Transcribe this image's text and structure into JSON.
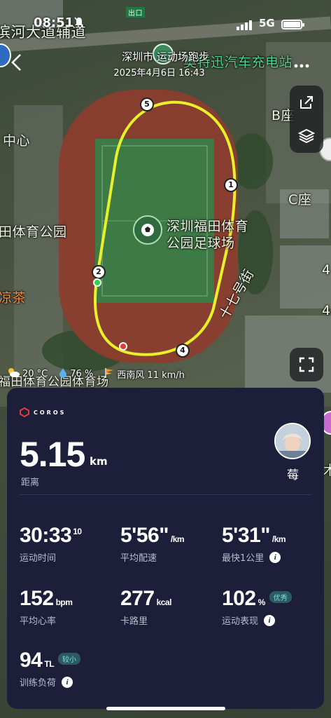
{
  "status_bar": {
    "time": "08:51",
    "network": "5G"
  },
  "header": {
    "title": "深圳市 运动场跑步",
    "subtitle": "2025年4月6日 16:43"
  },
  "map": {
    "labels": {
      "road_top": "滨河大道辅道",
      "poi_top_right": "奥特迅汽车充电站",
      "building_b": "B座",
      "building_c": "C座",
      "center_left": "中心",
      "park_left": "田体育公园",
      "tea": "凉茶",
      "stadium": "深圳福田体育",
      "stadium_line2": "公园足球场",
      "street": "十七号街",
      "park_bottom": "福田体育公园体育场",
      "edge_4a": "4",
      "edge_4b": "4",
      "edge_mu": "木",
      "exit_sign": "出口"
    },
    "route_markers": [
      "1",
      "2",
      "4",
      "5"
    ],
    "route_color": "#e8f02a"
  },
  "weather": {
    "temperature": "20 °C",
    "humidity": "76 %",
    "wind": "西南风 11 km/h"
  },
  "card": {
    "brand": "COROS",
    "distance": {
      "value": "5.15",
      "unit": "km",
      "label": "距离"
    },
    "user_name": "莓",
    "stats": {
      "duration": {
        "value": "30:33",
        "sup": "10",
        "label": "运动时间"
      },
      "avg_pace": {
        "value": "5'56\"",
        "unit": "/km",
        "label": "平均配速"
      },
      "fastest_km": {
        "value": "5'31\"",
        "unit": "/km",
        "label": "最快1公里"
      },
      "avg_hr": {
        "value": "152",
        "unit": "bpm",
        "label": "平均心率"
      },
      "calories": {
        "value": "277",
        "unit": "kcal",
        "label": "卡路里"
      },
      "performance": {
        "value": "102",
        "unit": "%",
        "badge": "优秀",
        "label": "运动表现"
      },
      "training_load": {
        "value": "94",
        "unit": "TL",
        "badge": "较小",
        "label": "训练负荷"
      }
    }
  },
  "colors": {
    "card_bg": "#1d1e3a",
    "accent_brand": "#e23c3c",
    "badge_text": "#7ee0d8"
  }
}
